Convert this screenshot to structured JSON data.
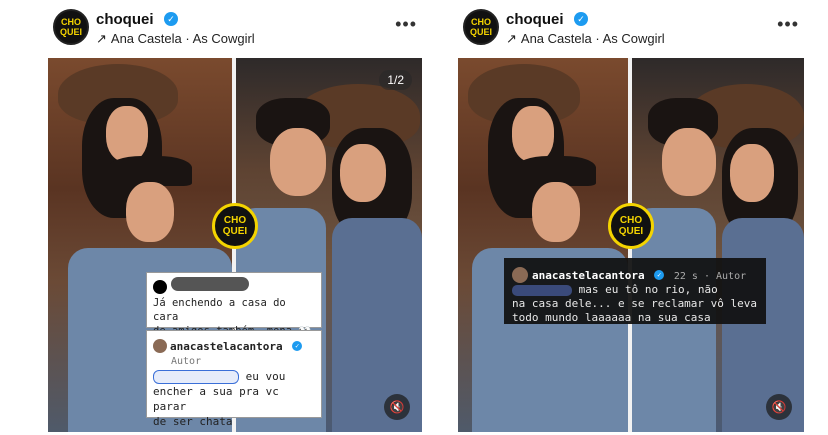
{
  "posts": [
    {
      "header": {
        "avatar_text": "CHO QUEI",
        "username": "choquei",
        "verified_mark": "✓",
        "music": "Ana Castela · As Cowgirl",
        "more": "•••"
      },
      "media": {
        "counter": "1/2",
        "center_logo": "CHO QUEI",
        "mute_icon": "speaker-off-icon"
      },
      "comments": [
        {
          "text_line1": "Já enchendo a casa do cara",
          "text_line2": "de amigos também, mona 👀"
        },
        {
          "name": "anacastelacantora",
          "role": "Autor",
          "text_line1": "eu vou",
          "text_line2": "encher a sua pra vc parar",
          "text_line3": "de ser chata"
        }
      ]
    },
    {
      "header": {
        "avatar_text": "CHO QUEI",
        "username": "choquei",
        "verified_mark": "✓",
        "music": "Ana Castela · As Cowgirl",
        "more": "•••"
      },
      "media": {
        "center_logo": "CHO QUEI",
        "mute_icon": "speaker-off-icon"
      },
      "comment": {
        "name": "anacastelacantora",
        "meta": "22 s · Autor",
        "text_line1": "mas eu tô no rio, não",
        "text_line2": "na casa dele... e se reclamar vô leva",
        "text_line3": "todo mundo laaaaaa na sua casa"
      }
    }
  ]
}
